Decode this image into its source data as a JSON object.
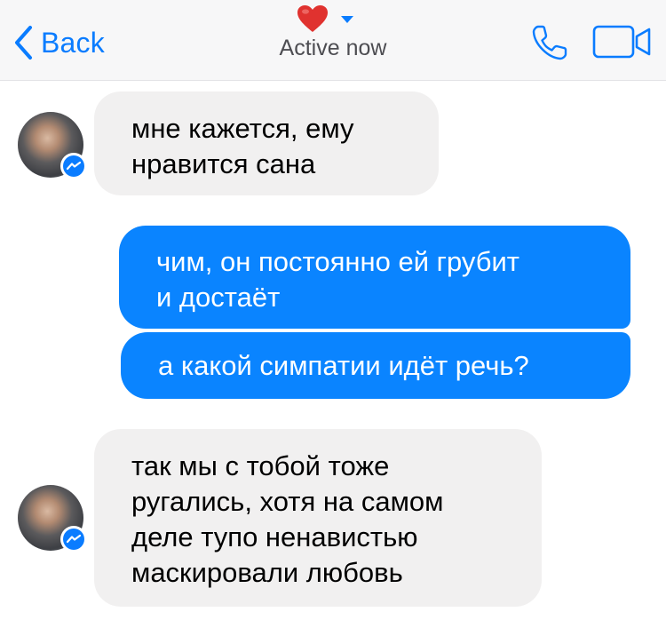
{
  "header": {
    "back_label": "Back",
    "status": "Active now",
    "heart_color": "#e0322f",
    "accent_color": "#0a7cff"
  },
  "messages": [
    {
      "direction": "incoming",
      "lines": [
        "мне кажется, ему",
        "нравится сана"
      ]
    },
    {
      "direction": "outgoing",
      "lines": [
        "чим, он постоянно ей грубит",
        "и достаёт"
      ]
    },
    {
      "direction": "outgoing",
      "lines": [
        "а какой симпатии идёт речь?"
      ]
    },
    {
      "direction": "incoming",
      "lines": [
        "так мы с тобой тоже",
        "ругались, хотя на самом",
        "деле тупо ненавистью",
        "маскировали любовь"
      ]
    }
  ],
  "colors": {
    "incoming_bubble": "#f1f0f0",
    "outgoing_bubble": "#0a84ff",
    "messenger_badge": "#0a7cff"
  },
  "icons": {
    "back": "chevron-left-icon",
    "heart": "heart-icon",
    "caret": "caret-down-icon",
    "call": "phone-icon",
    "video": "video-camera-icon",
    "badge": "messenger-icon"
  }
}
